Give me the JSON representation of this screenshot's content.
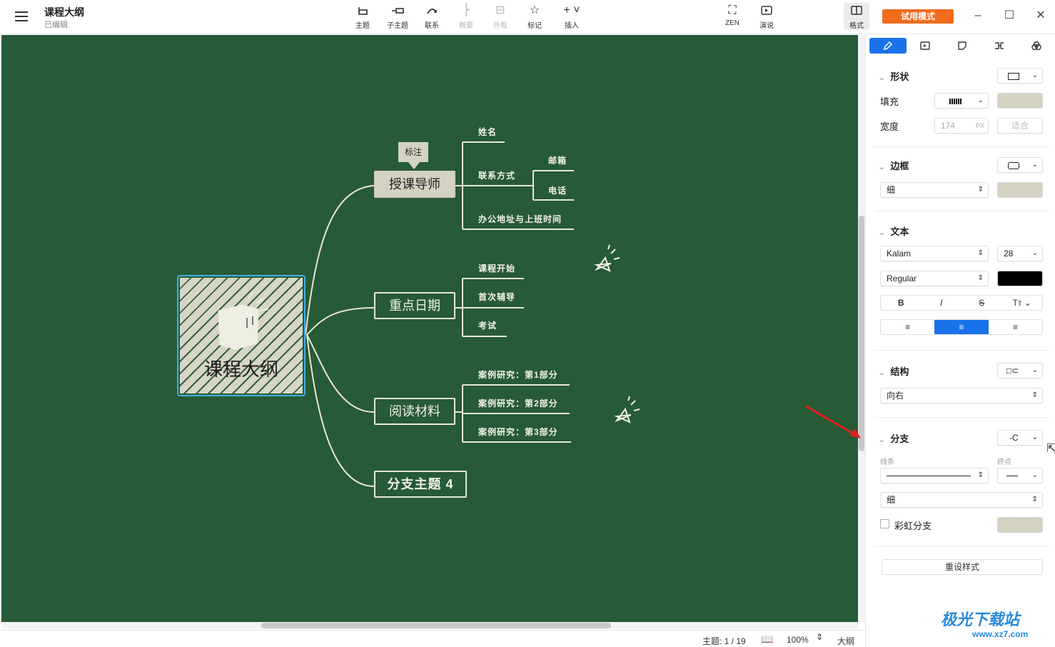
{
  "app": {
    "title": "课程大纲",
    "status": "已编辑",
    "trial_label": "试用模式"
  },
  "toolbar": {
    "topic": "主题",
    "subtopic": "子主题",
    "relation": "联系",
    "summary": "概要",
    "boundary": "外框",
    "marker": "标记",
    "insert": "插入",
    "zen": "ZEN",
    "pitch": "演说",
    "format": "格式"
  },
  "map": {
    "central": "课程大纲",
    "callout": "标注",
    "branches": [
      {
        "label": "授课导师",
        "leaves": [
          "姓名",
          "联系方式",
          "办公地址与上班时间"
        ],
        "sub_leaves": [
          "邮箱",
          "电话"
        ]
      },
      {
        "label": "重点日期",
        "leaves": [
          "课程开始",
          "首次辅导",
          "考试"
        ]
      },
      {
        "label": "阅读材料",
        "leaves": [
          "案例研究：第1部分",
          "案例研究：第2部分",
          "案例研究：第3部分"
        ]
      },
      {
        "label": "分支主题 4",
        "leaves": []
      }
    ]
  },
  "statusbar": {
    "topic_count": "主题: 1 / 19",
    "zoom": "100%",
    "outline": "大纲"
  },
  "panel": {
    "shape": {
      "title": "形状",
      "fill_label": "填充",
      "width_label": "宽度",
      "width_value": "174",
      "width_unit": "PX",
      "fit": "适合"
    },
    "border": {
      "title": "边框",
      "weight": "细"
    },
    "text": {
      "title": "文本",
      "font": "Kalam",
      "size": "28",
      "style": "Regular",
      "bold": "B",
      "italic": "I",
      "strike": "S",
      "case": "Tт"
    },
    "structure": {
      "title": "结构",
      "direction": "向右"
    },
    "branch": {
      "title": "分支",
      "line_label": "线条",
      "end_label": "终点",
      "weight": "细",
      "rainbow": "彩虹分支"
    },
    "reset": "重设样式"
  },
  "watermark": {
    "main": "极光下载站",
    "sub": "www.xz7.com"
  },
  "colors": {
    "canvas": "#275a36",
    "accent": "#1a73e8",
    "trial": "#f26b1d",
    "node_fill": "#d4d3c1",
    "swatch": "#d4d3c1",
    "text_color": "#000000"
  }
}
